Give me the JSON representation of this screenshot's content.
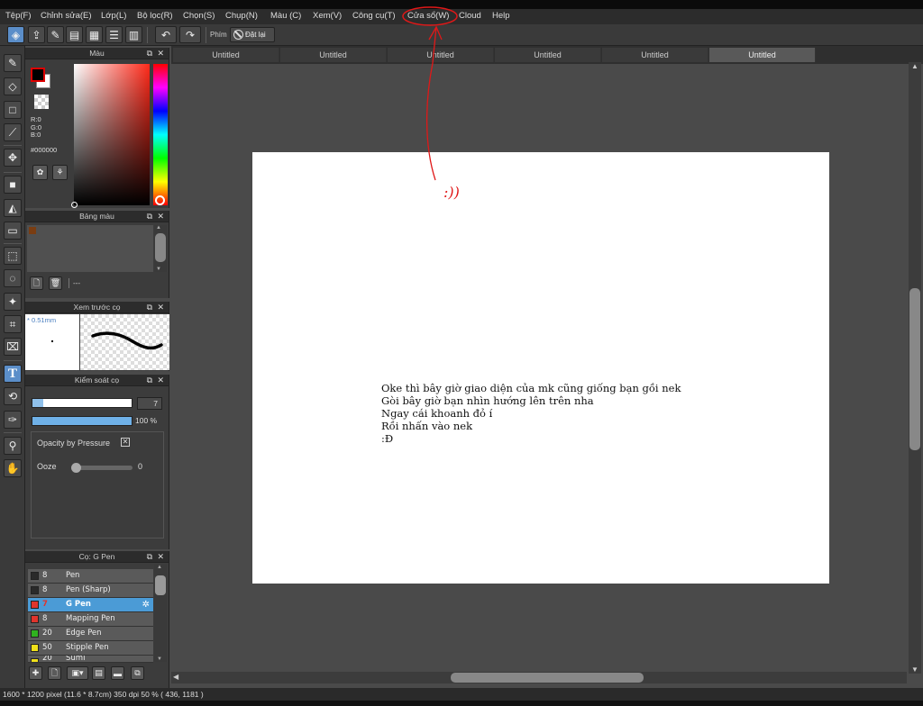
{
  "menu": [
    "Tệp(F)",
    "Chỉnh sửa(E)",
    "Lớp(L)",
    "Bộ lọc(R)",
    "Chọn(S)",
    "Chụp(N)",
    "Màu (C)",
    "Xem(V)",
    "Công cụ(T)",
    "Cửa sổ(W)",
    "Cloud",
    "Help"
  ],
  "toolbar": {
    "snap_label": "Phím",
    "reset_label": "Đặt lại"
  },
  "tabs": [
    "Untitled",
    "Untitled",
    "Untitled",
    "Untitled",
    "Untitled",
    "Untitled"
  ],
  "color_panel": {
    "title": "Màu",
    "r": "R:0",
    "g": "G:0",
    "b": "B:0",
    "hex": "#000000",
    "primary": "#000000",
    "secondary": "#ffffff",
    "hue_color": "#ff2a1a"
  },
  "palette_panel": {
    "title": "Bảng màu",
    "name": "---",
    "swatch": "#7a3d12"
  },
  "preview_panel": {
    "title": "Xem trước cọ",
    "size": "* 0.51mm"
  },
  "brush_control": {
    "title": "Kiểm soát cọ",
    "size_value": "7",
    "opacity_value": "100 %",
    "opacity_pressure_label": "Opacity by Pressure",
    "ooze_label": "Ooze",
    "ooze_value": "0"
  },
  "brush_list": {
    "title": "Cọ: G Pen",
    "items": [
      {
        "size": "8",
        "name": "Pen",
        "color": "#2a2a2a"
      },
      {
        "size": "8",
        "name": "Pen (Sharp)",
        "color": "#2a2a2a"
      },
      {
        "size": "7",
        "name": "G Pen",
        "color": "#e0342c"
      },
      {
        "size": "8",
        "name": "Mapping Pen",
        "color": "#e0342c"
      },
      {
        "size": "20",
        "name": "Edge Pen",
        "color": "#2fb21f"
      },
      {
        "size": "50",
        "name": "Stipple Pen",
        "color": "#f0e01a"
      },
      {
        "size": "20",
        "name": "Sumi",
        "color": "#f0e01a"
      }
    ]
  },
  "canvas_text": [
    "Oke thì bây giờ giao diện của mk cũng giống bạn gồi nek",
    "Gòi bây giờ bạn nhìn hướng lên trên nha",
    "Ngay cái khoanh đỏ í",
    "Rồi nhấn vào nek",
    ":Đ"
  ],
  "annotation_text": ":))",
  "status_text": "1600 * 1200 pixel  (11.6 * 8.7cm)  350 dpi  50 %  ( 436, 1181 )"
}
